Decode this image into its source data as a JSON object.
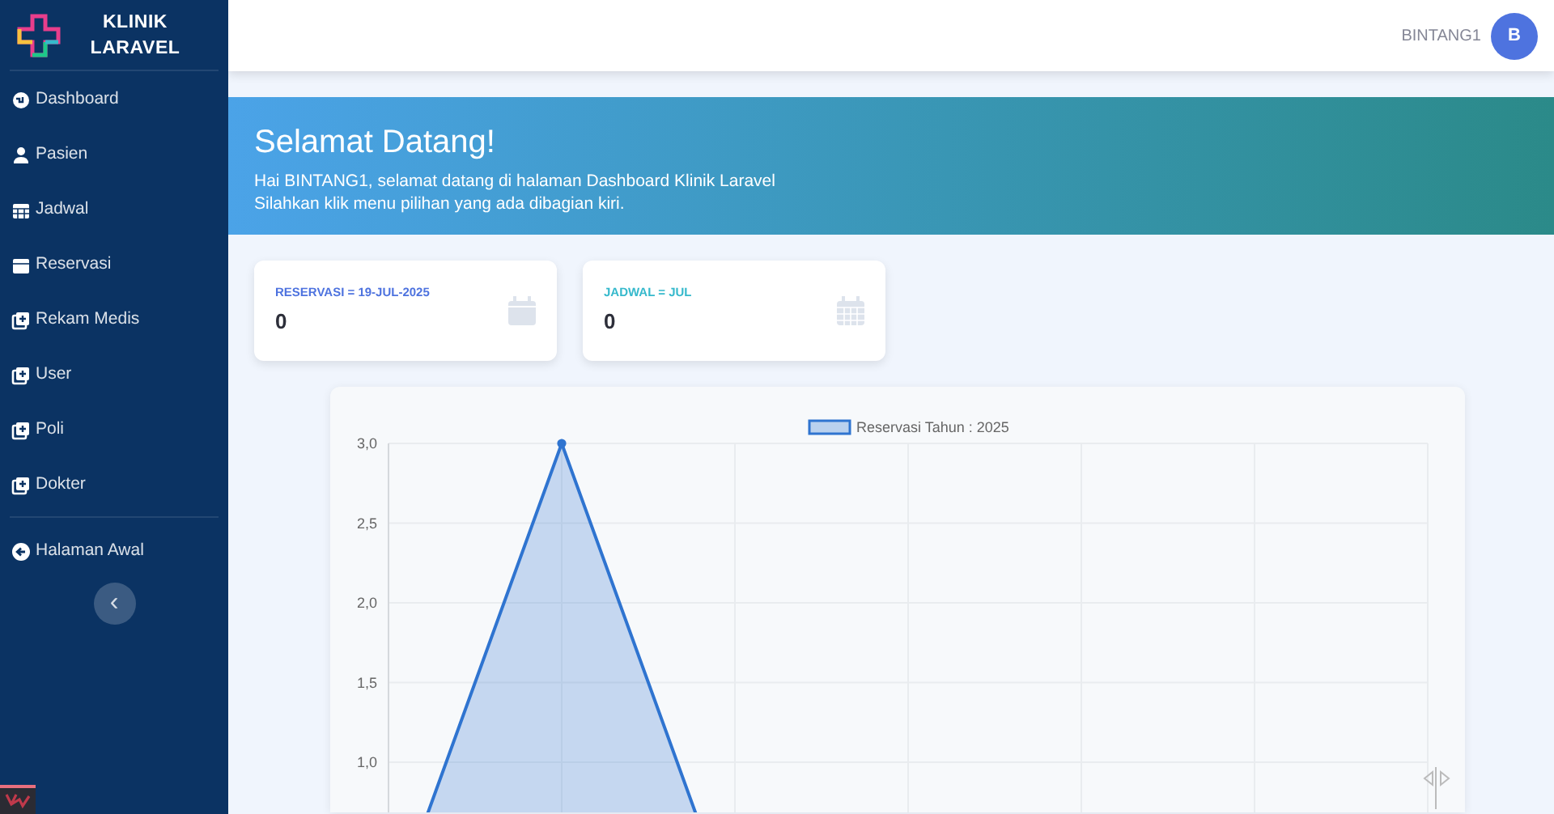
{
  "brand": {
    "line_1": "KLINIK",
    "line_2": "LARAVEL"
  },
  "sidebar": {
    "items": [
      {
        "label": "Dashboard",
        "selected": false
      },
      {
        "label": "Pasien",
        "selected": false
      },
      {
        "label": "Jadwal",
        "selected": false
      },
      {
        "label": "Reservasi",
        "selected": false
      },
      {
        "label": "Rekam Medis",
        "selected": false
      },
      {
        "label": "User",
        "selected": false
      },
      {
        "label": "Poli",
        "selected": false
      },
      {
        "label": "Dokter",
        "selected": false
      }
    ],
    "footer_items": [
      {
        "label": "Halaman Awal"
      }
    ],
    "toggle": "‹"
  },
  "topbar": {
    "user_name": "BINTANG1",
    "avatar": "B"
  },
  "banner": {
    "title": "Selamat Datang!",
    "lines": [
      "Hai BINTANG1, selamat datang di halaman Dashboard Klinik Laravel",
      "Silahkan klik menu pilihan yang ada dibagian kiri."
    ]
  },
  "cards": [
    {
      "label": "RESERVASI = 19-JUL-2025",
      "value": "0",
      "color": "#4e73df"
    },
    {
      "label": "JADWAL = JUL",
      "value": "0",
      "color": "#36b9cc"
    }
  ],
  "chart": {
    "chart_data": {
      "type": "area",
      "grid": true,
      "series": [
        {
          "name": "Reservasi Tahun : 2025",
          "color": "#2f74d0",
          "values": [
            0,
            3,
            0,
            0,
            0,
            0,
            0
          ]
        }
      ],
      "ylim": [
        0,
        3
      ],
      "yticks": [
        {
          "value": 1,
          "label": "1,0"
        },
        {
          "value": 1.5,
          "label": "1,5"
        },
        {
          "value": 2,
          "label": "2,0"
        },
        {
          "value": 2.5,
          "label": "2,5"
        },
        {
          "value": 3,
          "label": "3,0"
        }
      ]
    }
  }
}
